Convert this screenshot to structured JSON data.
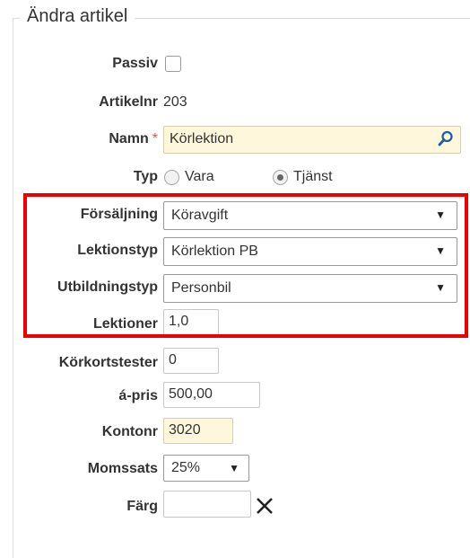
{
  "form": {
    "title": "Ändra artikel"
  },
  "fields": {
    "passiv": {
      "label": "Passiv"
    },
    "artikelnr": {
      "label": "Artikelnr",
      "value": "203"
    },
    "namn": {
      "label": "Namn",
      "required_marker": "*",
      "value": "Körlektion"
    },
    "typ": {
      "label": "Typ",
      "options": [
        "Vara",
        "Tjänst"
      ],
      "selected": "Tjänst"
    },
    "forsaljning": {
      "label": "Försäljning",
      "value": "Köravgift"
    },
    "lektionstyp": {
      "label": "Lektionstyp",
      "value": "Körlektion PB"
    },
    "utbildningstyp": {
      "label": "Utbildningstyp",
      "value": "Personbil"
    },
    "lektioner": {
      "label": "Lektioner",
      "value": "1,0"
    },
    "korkortstester": {
      "label": "Körkortstester",
      "value": "0"
    },
    "apris": {
      "label": "á-pris",
      "value": "500,00"
    },
    "kontonr": {
      "label": "Kontonr",
      "value": "3020"
    },
    "momssats": {
      "label": "Momssats",
      "value": "25%"
    },
    "farg": {
      "label": "Färg",
      "value": ""
    }
  },
  "icons": {
    "search": "search-icon",
    "clear": "close-icon",
    "dropdown": "chevron-down-icon"
  },
  "colors": {
    "highlight": "#ee0000",
    "input_highlight": "#fff7dc",
    "required": "#d9534f"
  }
}
